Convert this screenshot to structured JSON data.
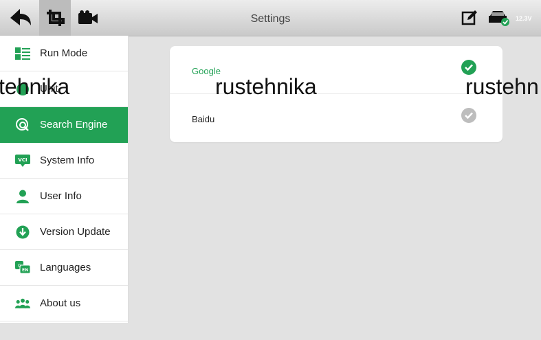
{
  "header": {
    "title": "Settings",
    "voltage": "12.3V",
    "icons": [
      "back-arrow-icon",
      "crop-icon",
      "video-camera-icon",
      "edit-icon",
      "car-connected-icon"
    ]
  },
  "sidebar": {
    "items": [
      {
        "label": "Run Mode",
        "icon": "list-icon",
        "active": false
      },
      {
        "label": "Unit",
        "icon": "unit-icon",
        "active": false
      },
      {
        "label": "Search Engine",
        "icon": "search-globe-icon",
        "active": true
      },
      {
        "label": "System Info",
        "icon": "vci-icon",
        "active": false
      },
      {
        "label": "User Info",
        "icon": "user-icon",
        "active": false
      },
      {
        "label": "Version Update",
        "icon": "download-icon",
        "active": false
      },
      {
        "label": "Languages",
        "icon": "language-icon",
        "active": false
      },
      {
        "label": "About us",
        "icon": "group-icon",
        "active": false
      }
    ]
  },
  "search_engine": {
    "options": [
      {
        "label": "Google",
        "selected": true
      },
      {
        "label": "Baidu",
        "selected": false
      }
    ]
  },
  "watermark": {
    "left": "tehnika",
    "center": "rustehnika",
    "right": "rustehn"
  },
  "colors": {
    "accent": "#22a155",
    "unselected_check": "#bdbdbd"
  }
}
